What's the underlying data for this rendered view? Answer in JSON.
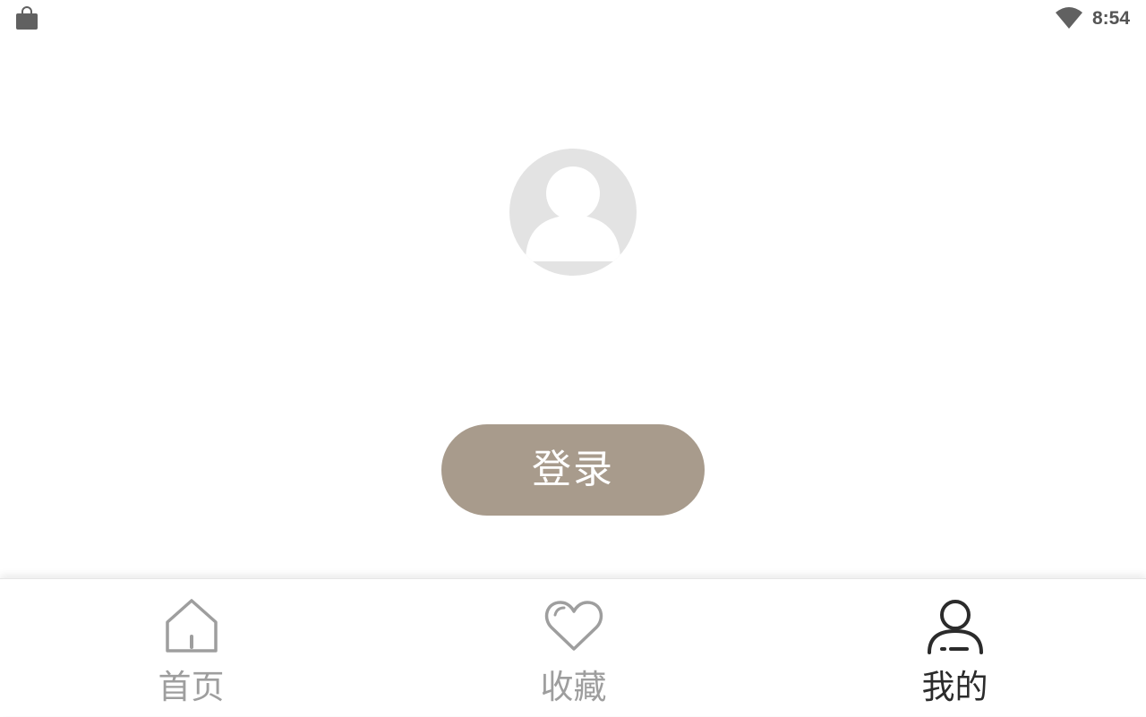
{
  "status_bar": {
    "time": "8:54",
    "icons": [
      "shopping-bag-icon",
      "wifi-icon"
    ]
  },
  "profile": {
    "avatar_icon": "default-avatar-icon",
    "login_label": "登录"
  },
  "tab_bar": {
    "active": "我的",
    "tabs": [
      {
        "label": "首页",
        "icon": "home-icon"
      },
      {
        "label": "收藏",
        "icon": "heart-icon"
      },
      {
        "label": "我的",
        "icon": "user-icon"
      }
    ]
  },
  "colors": {
    "login_button": "#a89b8c",
    "avatar_bg": "#e3e3e3",
    "tab_inactive": "#9e9e9e",
    "tab_active": "#2b2b2b"
  }
}
